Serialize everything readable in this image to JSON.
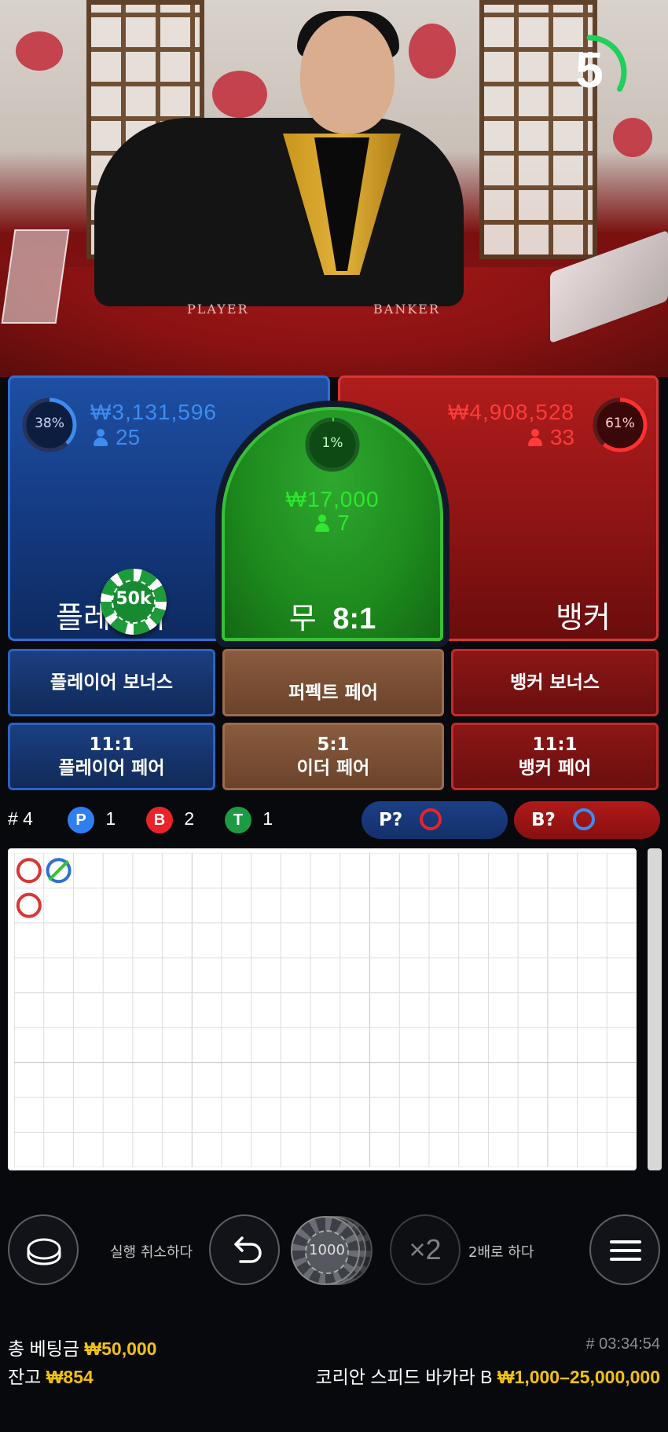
{
  "timer": {
    "value": "5",
    "progress": 0.33
  },
  "table_labels": {
    "player": "PLAYER",
    "banker": "BANKER"
  },
  "player": {
    "percent": "38%",
    "percent_value": 0.38,
    "amount": "₩3,131,596",
    "count": "25",
    "label": "플레이어",
    "chip": "50k"
  },
  "tie": {
    "percent": "1%",
    "percent_value": 0.01,
    "amount": "₩17,000",
    "count": "7",
    "label": "무",
    "odds": "8:1"
  },
  "banker": {
    "percent": "61%",
    "percent_value": 0.61,
    "amount": "₩4,908,528",
    "count": "33",
    "label": "뱅커"
  },
  "side_bets": {
    "player_bonus": "플레이어 보너스",
    "perfect_pair": "퍼펙트 페어",
    "banker_bonus": "뱅커 보너스",
    "player_pair_odds": "11:1",
    "player_pair": "플레이어 페어",
    "either_pair_odds": "5:1",
    "either_pair": "이더 페어",
    "banker_pair_odds": "11:1",
    "banker_pair": "뱅커 페어"
  },
  "stats": {
    "round": "# 4",
    "p_letter": "P",
    "p_count": "1",
    "b_letter": "B",
    "b_count": "2",
    "t_letter": "T",
    "t_count": "1",
    "predict_player": "P?",
    "predict_banker": "B?"
  },
  "road": {
    "cells": [
      {
        "col": 0,
        "row": 0,
        "result": "banker"
      },
      {
        "col": 1,
        "row": 0,
        "result": "player-tie"
      },
      {
        "col": 0,
        "row": 1,
        "result": "banker"
      }
    ]
  },
  "controls": {
    "undo_label": "실행 취소하다",
    "chip_value": "1000",
    "double_symbol": "×2",
    "double_label": "2배로 하다"
  },
  "footer": {
    "total_bet_label": "총 베팅금",
    "total_bet": "₩50,000",
    "balance_label": "잔고",
    "balance": "₩854",
    "round_id": "# 03:34:54",
    "table_name": "코리안 스피드 바카라 B",
    "limits": "₩1,000–25,000,000"
  },
  "colors": {
    "player": "#2f6fd6",
    "banker": "#d93636",
    "tie": "#38c038",
    "gold": "#f2c20f",
    "player_text": "#3d8cf0",
    "banker_text": "#ff3b3b",
    "tie_text": "#2ee82e"
  }
}
